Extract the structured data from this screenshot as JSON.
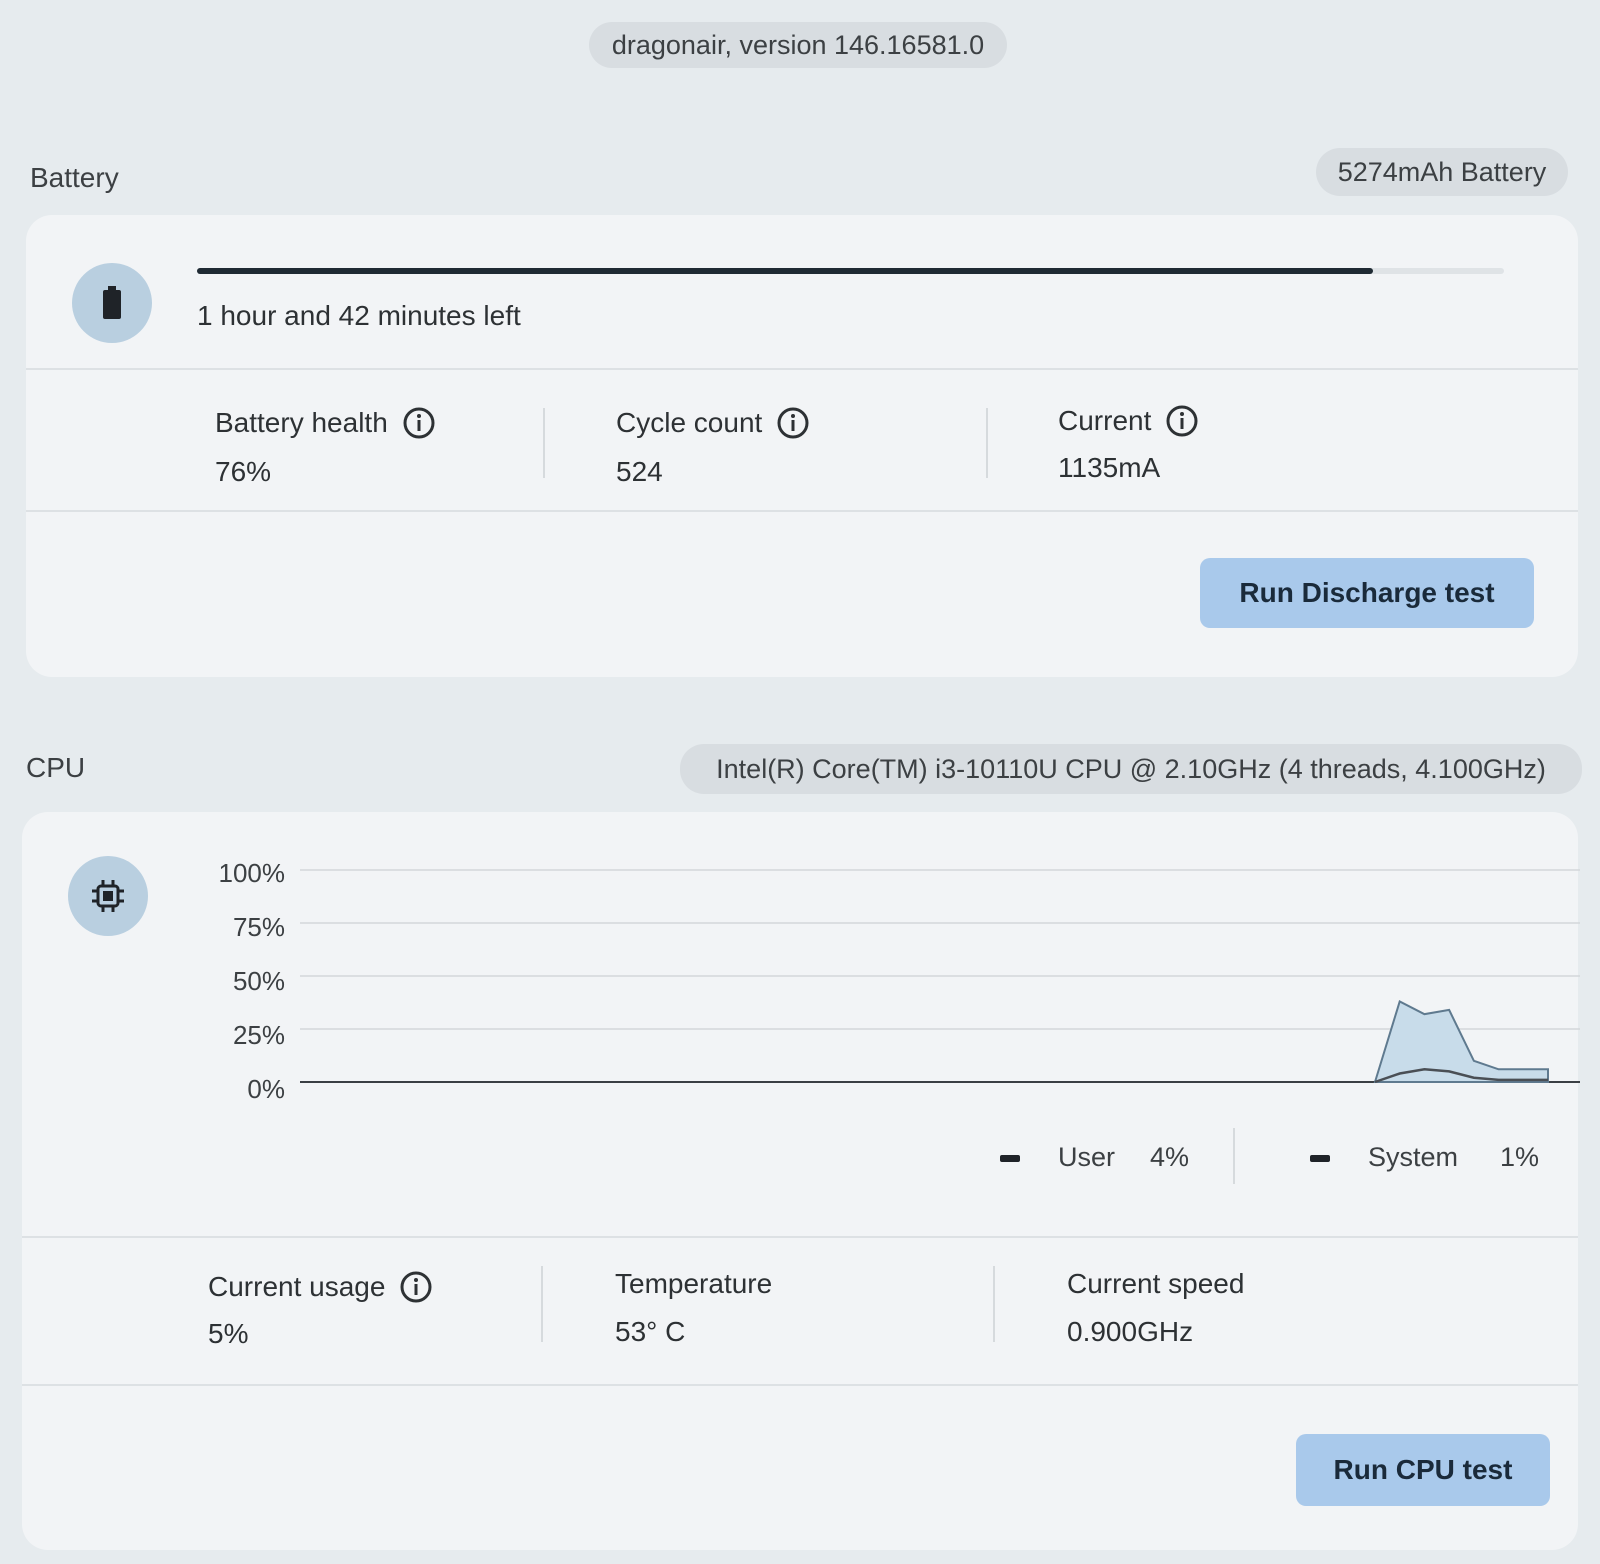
{
  "header": {
    "version": "dragonair, version 146.16581.0"
  },
  "battery": {
    "title": "Battery",
    "chip": "5274mAh Battery",
    "icon": "battery-icon",
    "time_left": "1 hour and 42 minutes left",
    "charge_level": 0.9,
    "metrics": [
      {
        "label": "Battery health",
        "value": "76%",
        "info": true
      },
      {
        "label": "Cycle count",
        "value": "524",
        "info": true
      },
      {
        "label": "Current",
        "value": "1135mA",
        "info": true
      }
    ],
    "button": "Run Discharge test"
  },
  "cpu": {
    "title": "CPU",
    "chip": "Intel(R) Core(TM) i3-10110U CPU @ 2.10GHz (4 threads, 4.100GHz)",
    "icon": "cpu-chip-icon",
    "legend": [
      {
        "label": "User",
        "value": "4%"
      },
      {
        "label": "System",
        "value": "1%"
      }
    ],
    "metrics": [
      {
        "label": "Current usage",
        "value": "5%",
        "info": true
      },
      {
        "label": "Temperature",
        "value": "53° C",
        "info": false
      },
      {
        "label": "Current speed",
        "value": "0.900GHz",
        "info": false
      }
    ],
    "button": "Run CPU test"
  },
  "chart_data": {
    "type": "area",
    "y_ticks": [
      "100%",
      "75%",
      "50%",
      "25%",
      "0%"
    ],
    "ylim": [
      0,
      100
    ],
    "x": [
      0,
      1,
      2,
      3,
      4,
      5,
      6,
      7
    ],
    "series": [
      {
        "name": "User",
        "values": [
          0,
          38,
          32,
          34,
          10,
          6,
          6,
          6
        ]
      },
      {
        "name": "System",
        "values": [
          0,
          4,
          6,
          5,
          2,
          1,
          1,
          1
        ]
      }
    ],
    "colors": {
      "user_fill": "#c8dcea",
      "user_line": "#5f7a8f",
      "system_line": "#4a4f55",
      "grid": "#d3d7da"
    }
  }
}
